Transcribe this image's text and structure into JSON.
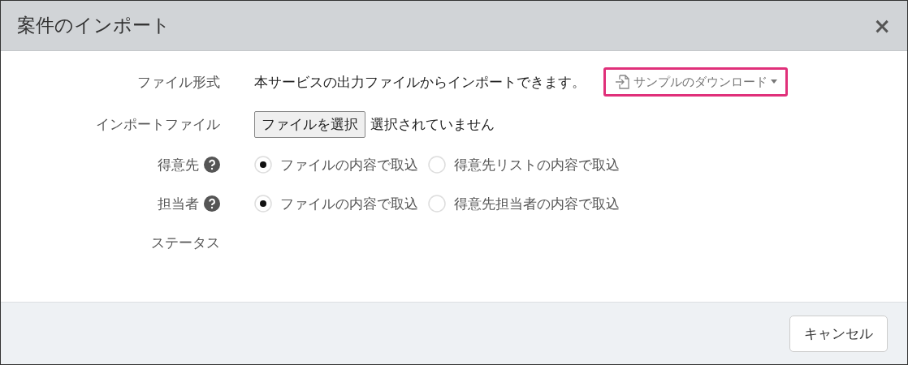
{
  "dialog": {
    "title": "案件のインポート",
    "close": "×"
  },
  "rows": [
    {
      "kind": "text",
      "label": "ファイル形式",
      "help": false,
      "text": "本サービスの出力ファイルからインポートできます。",
      "link": "サンプルのダウンロード"
    },
    {
      "kind": "file",
      "label": "インポートファイル",
      "help": false,
      "button": "ファイルを選択",
      "status": "選択されていません"
    },
    {
      "kind": "radio",
      "label": "得意先",
      "help": true,
      "options": [
        {
          "label": "ファイルの内容で取込",
          "selected": true
        },
        {
          "label": "得意先リストの内容で取込",
          "selected": false
        }
      ]
    },
    {
      "kind": "radio",
      "label": "担当者",
      "help": true,
      "options": [
        {
          "label": "ファイルの内容で取込",
          "selected": true
        },
        {
          "label": "得意先担当者の内容で取込",
          "selected": false
        }
      ]
    },
    {
      "kind": "empty",
      "label": "ステータス",
      "help": false
    }
  ],
  "footer": {
    "buttons": [
      "キャンセル"
    ]
  }
}
